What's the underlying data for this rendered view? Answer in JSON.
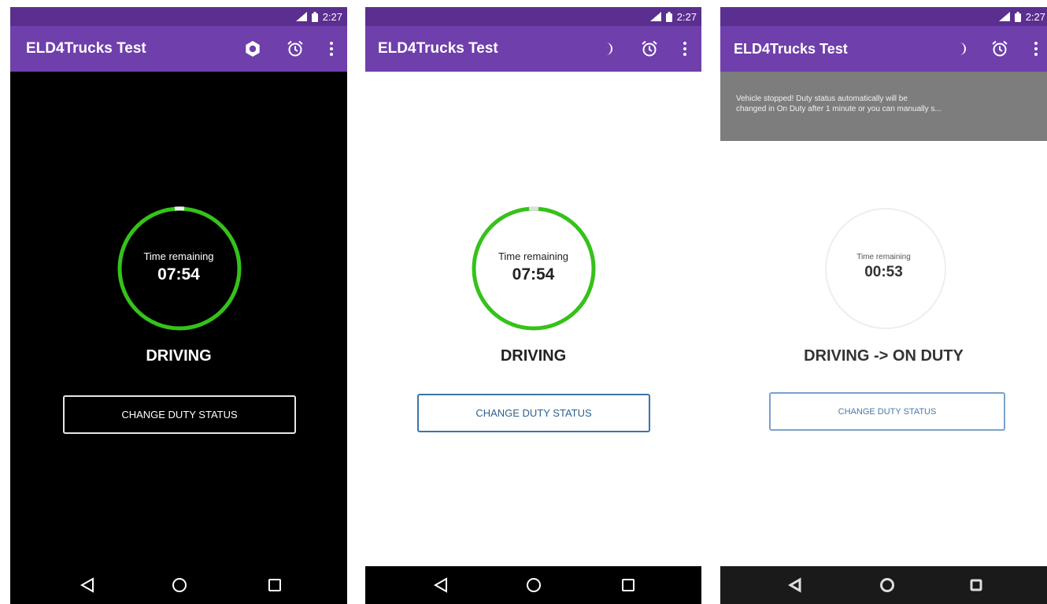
{
  "colors": {
    "app_bar": "#6f3fab",
    "status_bar": "#5a2f8f",
    "ring_green": "#35c21a",
    "ring_gap": "#eeeeee",
    "button_blue": "#3d74a8",
    "snackbar_gray": "#7d7d7d"
  },
  "status_bar": {
    "time": "2:27"
  },
  "app": {
    "title": "ELD4Trucks Test"
  },
  "screens": [
    {
      "theme": "dark",
      "time_label": "Time remaining",
      "time_value": "07:54",
      "status": "DRIVING",
      "button_label": "CHANGE DUTY STATUS",
      "theme_icon": "brightness-icon"
    },
    {
      "theme": "light",
      "time_label": "Time remaining",
      "time_value": "07:54",
      "status": "DRIVING",
      "button_label": "CHANGE DUTY STATUS",
      "theme_icon": "moon-icon"
    },
    {
      "theme": "light",
      "snackbar": {
        "line1": "Vehicle stopped! Duty status automatically will be",
        "line2": "changed in On Duty after 1 minute or you can manually s..."
      },
      "time_label": "Time remaining",
      "time_value": "00:53",
      "status": "DRIVING -> ON DUTY",
      "button_label": "CHANGE DUTY STATUS",
      "theme_icon": "moon-icon"
    }
  ],
  "icons": {
    "alarm": "alarm-icon",
    "overflow": "more-vert-icon",
    "back": "back-triangle-icon",
    "home": "home-circle-icon",
    "recents": "recents-square-icon",
    "signal": "signal-icon",
    "battery": "battery-icon"
  }
}
